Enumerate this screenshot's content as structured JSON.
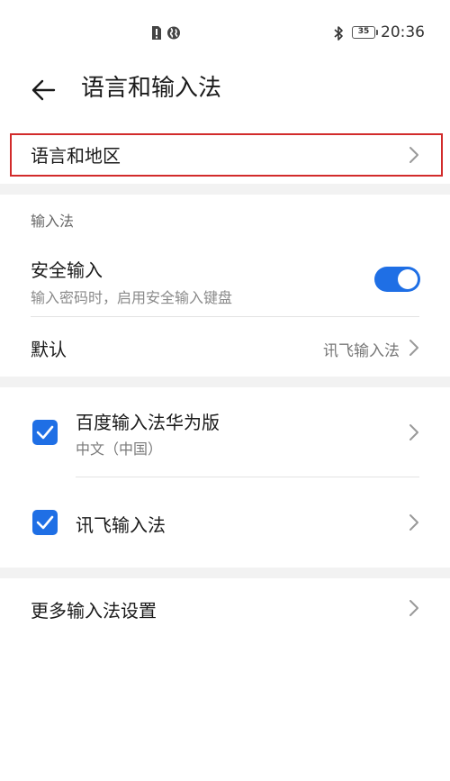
{
  "status_bar": {
    "time": "20:36",
    "battery": "35",
    "icons": [
      "alert-sim-icon",
      "globe-icon",
      "bluetooth-icon",
      "battery-icon"
    ]
  },
  "header": {
    "title": "语言和输入法"
  },
  "language_region": {
    "label": "语言和地区"
  },
  "input_method_section": {
    "header": "输入法",
    "secure_input": {
      "title": "安全输入",
      "subtitle": "输入密码时，启用安全输入键盘",
      "enabled": true
    },
    "default": {
      "label": "默认",
      "value": "讯飞输入法"
    }
  },
  "keyboards": [
    {
      "name": "百度输入法华为版",
      "subtitle": "中文（中国）",
      "checked": true
    },
    {
      "name": "讯飞输入法",
      "checked": true
    }
  ],
  "more_settings": {
    "label": "更多输入法设置"
  },
  "colors": {
    "accent": "#1f6fe5",
    "highlight": "#d22b2b",
    "section_band": "#f2f2f2"
  }
}
